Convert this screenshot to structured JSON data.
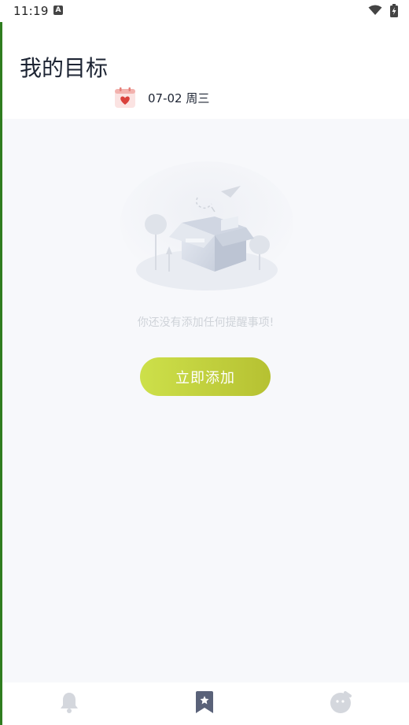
{
  "status_bar": {
    "time": "11:19",
    "notification_letter": "A",
    "icons": [
      "wifi-icon",
      "battery-charging-icon"
    ]
  },
  "header": {
    "title": "我的目标"
  },
  "date_selector": {
    "icon": "calendar-heart-icon",
    "date_label": "07-02 周三"
  },
  "empty_state": {
    "illustration": "empty-box-illustration",
    "message": "你还没有添加任何提醒事项!",
    "button_label": "立即添加"
  },
  "tab_bar": {
    "tabs": [
      {
        "icon": "bell-icon",
        "active": false
      },
      {
        "icon": "star-bookmark-icon",
        "active": true
      },
      {
        "icon": "face-icon",
        "active": false
      }
    ]
  },
  "colors": {
    "accent_start": "#cde04a",
    "accent_end": "#b6c132",
    "content_bg": "#f7f8fb",
    "title_text": "#1d2433",
    "tab_active": "#5a6279",
    "tab_inactive": "#d4d7dd",
    "calendar_red": "#d9413c"
  }
}
